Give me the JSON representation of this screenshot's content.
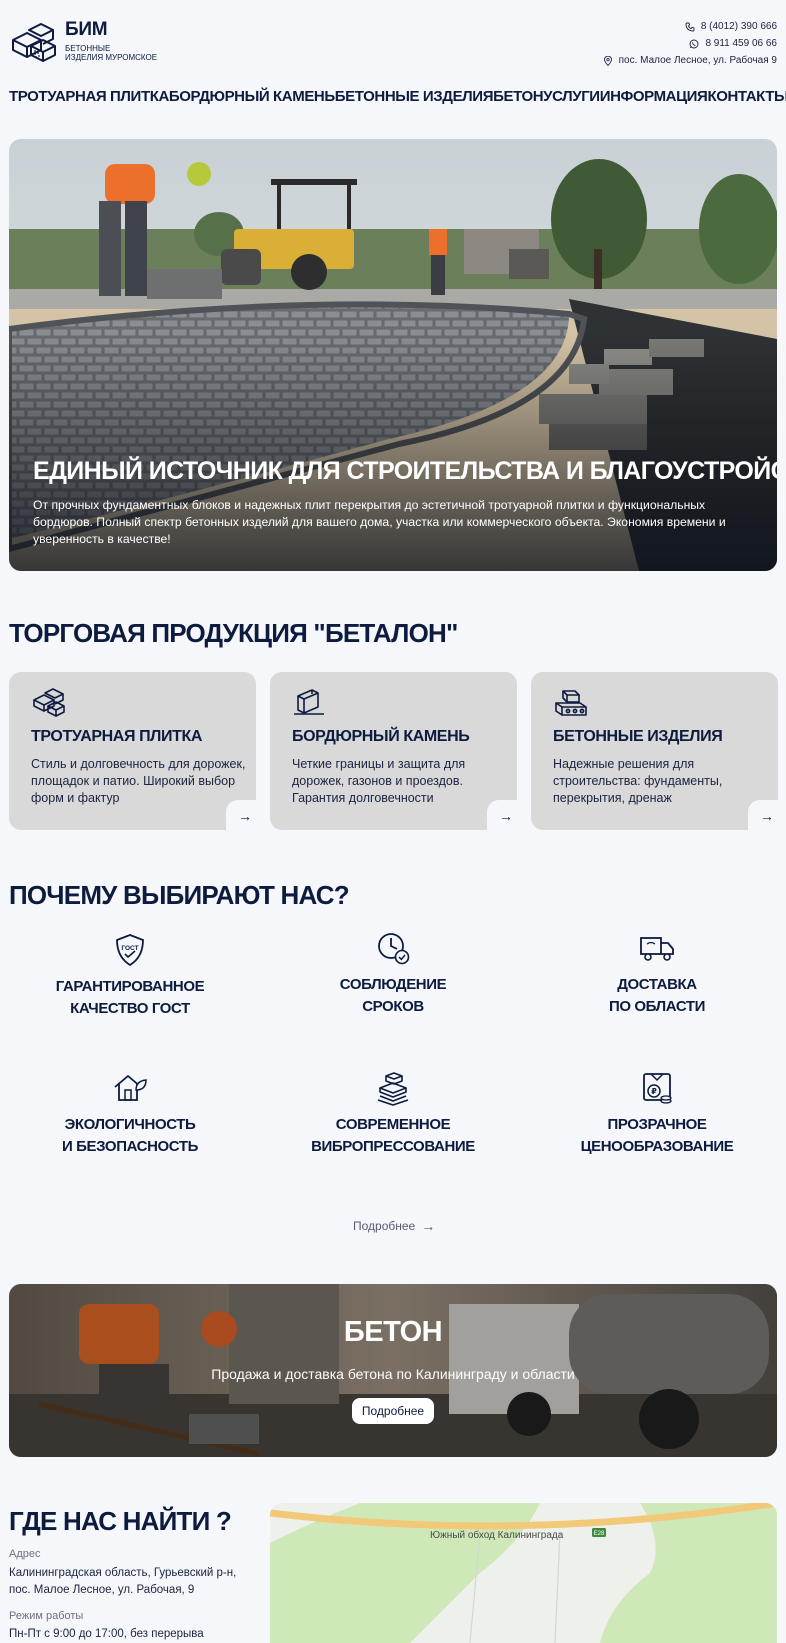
{
  "header": {
    "logo_name": "БИМ",
    "logo_sub_1": "БЕТОННЫЕ",
    "logo_sub_2": "ИЗДЕЛИЯ МУРОМСКОЕ",
    "phone_1": "8 (4012) 390 666",
    "phone_2": "8 911 459 06 66",
    "address": "пос. Малое Лесное, ул. Рабочая 9"
  },
  "nav": [
    {
      "label": "ТРОТУАРНАЯ ПЛИТКА"
    },
    {
      "label": "БОРДЮРНЫЙ КАМЕНЬ"
    },
    {
      "label": "БЕТОННЫЕ ИЗДЕЛИЯ"
    },
    {
      "label": "БЕТОН"
    },
    {
      "label": "УСЛУГИ"
    },
    {
      "label": "ИНФОРМАЦИЯ"
    },
    {
      "label": "КОНТАКТЫ"
    }
  ],
  "hero": {
    "title": "ЕДИНЫЙ ИСТОЧНИК ДЛЯ СТРОИТЕЛЬСТВА И БЛАГОУСТРОЙСТВА",
    "text": "От прочных фундаментных блоков и надежных плит перекрытия до эстетичной тротуарной плитки и функциональных бордюров. Полный спектр бетонных изделий для вашего дома, участка или коммерческого объекта. Экономия времени и уверенность в качестве!"
  },
  "products": {
    "title": "ТОРГОВАЯ ПРОДУКЦИЯ \"БЕТАЛОН\"",
    "cards": [
      {
        "title": "ТРОТУАРНАЯ ПЛИТКА",
        "text": "Стиль и долговечность для дорожек, площадок и патио. Широкий выбор форм и фактур",
        "icon": "paving-tiles-icon",
        "arrow": "→"
      },
      {
        "title": "БОРДЮРНЫЙ КАМЕНЬ",
        "text": "Четкие границы и защита для дорожек, газонов и проездов. Гарантия долговечности",
        "icon": "curb-stone-icon",
        "arrow": "→"
      },
      {
        "title": "БЕТОННЫЕ ИЗДЕЛИЯ",
        "text": "Надежные решения для строительства: фундаменты, перекрытия, дренаж",
        "icon": "concrete-blocks-icon",
        "arrow": "→"
      }
    ]
  },
  "why": {
    "title": "ПОЧЕМУ ВЫБИРАЮТ НАС?",
    "features": [
      {
        "line1": "ГАРАНТИРОВАННОЕ",
        "line2": "КАЧЕСТВО ГОСТ",
        "icon": "gost-shield-icon",
        "icon_text": "ГОСТ"
      },
      {
        "line1": "СОБЛЮДЕНИЕ",
        "line2": "СРОКОВ",
        "icon": "clock-check-icon"
      },
      {
        "line1": "ДОСТАВКА",
        "line2": "ПО ОБЛАСТИ",
        "icon": "delivery-truck-icon"
      },
      {
        "line1": "ЭКОЛОГИЧНОСТЬ",
        "line2": "И БЕЗОПАСНОСТЬ",
        "icon": "eco-house-icon"
      },
      {
        "line1": "СОВРЕМЕННОЕ",
        "line2": "ВИБРОПРЕССОВАНИЕ",
        "icon": "vibropress-icon"
      },
      {
        "line1": "ПРОЗРАЧНОЕ",
        "line2": "ЦЕНООБРАЗОВАНИЕ",
        "icon": "price-ruble-icon",
        "icon_text": "₽"
      }
    ],
    "more": "Подробнее",
    "more_arrow": "→"
  },
  "banner": {
    "title": "БЕТОН",
    "text": "Продажа и доставка бетона по Калининграду и области",
    "button": "Подробнее"
  },
  "find": {
    "title": "ГДЕ НАС НАЙТИ ?",
    "address_label": "Адрес",
    "address_1": "Калининградская область, Гурьевский р-н,",
    "address_2": "пос. Малое Лесное, ул. Рабочая, 9",
    "hours_label": "Режим работы",
    "hours": "Пн-Пт с 9:00 до 17:00, без перерыва",
    "map_road": "Южный обход Калининграда",
    "map_badge": "E28"
  }
}
